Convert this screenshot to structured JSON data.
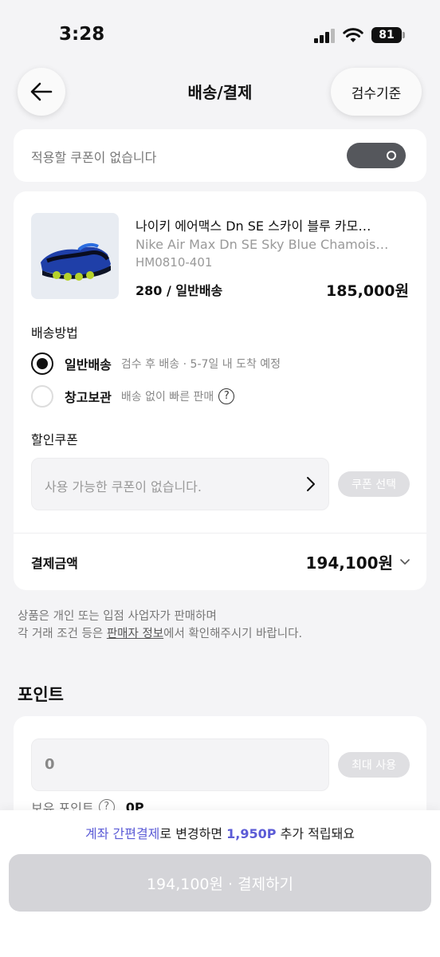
{
  "status_bar": {
    "time": "3:28",
    "battery": "81"
  },
  "header": {
    "title": "배송/결제",
    "inspect_button": "검수기준"
  },
  "coupon_toggle": {
    "text": "적용할 쿠폰이 없습니다",
    "toggle_state": "off"
  },
  "product": {
    "name_ko": "나이키 에어맥스 Dn SE 스카이 블루 카모…",
    "name_en": "Nike Air Max Dn SE Sky Blue Chamois…",
    "code": "HM0810-401",
    "option": "280 / 일반배송",
    "price": "185,000원"
  },
  "shipping": {
    "label": "배송방법",
    "options": [
      {
        "title": "일반배송",
        "desc": "검수 후 배송 · 5-7일 내 도착 예정",
        "selected": true
      },
      {
        "title": "창고보관",
        "desc": "배송 없이 빠른 판매",
        "selected": false
      }
    ],
    "help_glyph": "?"
  },
  "discount": {
    "label": "할인쿠폰",
    "placeholder": "사용 가능한 쿠폰이 없습니다.",
    "select_button": "쿠폰 선택"
  },
  "total": {
    "label": "결제금액",
    "value": "194,100원"
  },
  "notice": {
    "line1": "상품은 개인 또는 입점 사업자가 판매하며",
    "line2_pre": "각 거래 조건 등은 ",
    "line2_link": "판매자 정보",
    "line2_post": "에서 확인해주시기 바랍니다."
  },
  "points": {
    "title": "포인트",
    "input_value": "0",
    "max_button": "최대 사용",
    "own_label": "보유 포인트",
    "own_value": "0P"
  },
  "bottom": {
    "promo_accent": "계좌 간편결제",
    "promo_mid": "로 변경하면 ",
    "promo_points": "1,950P",
    "promo_end": " 추가 적립돼요",
    "pay_button": "194,100원 · 결제하기"
  },
  "colors": {
    "accent": "#5b5bd6",
    "disabled_button": "#d4d4d8",
    "toggle_off": "#55575c"
  }
}
